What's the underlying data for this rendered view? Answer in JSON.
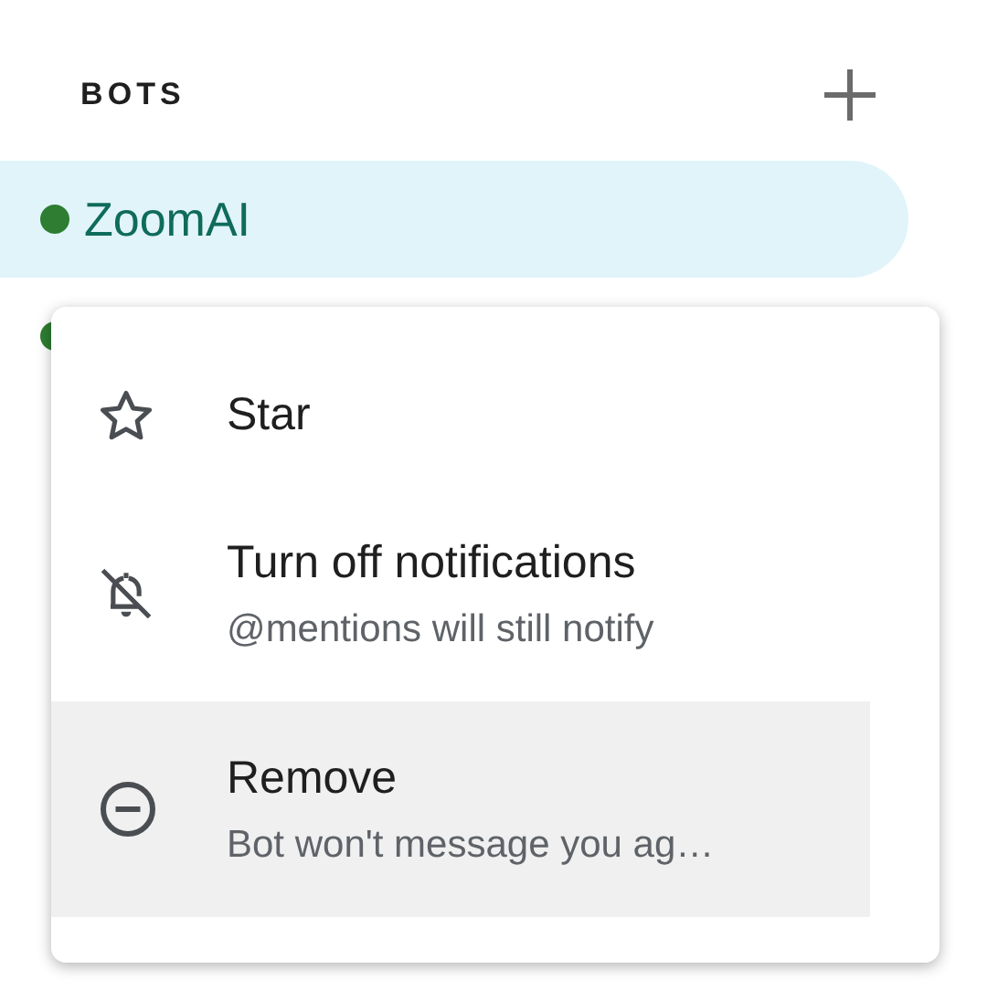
{
  "section": {
    "title": "BOTS"
  },
  "bots": [
    {
      "name": "ZoomAI",
      "selected": true,
      "online": true
    },
    {
      "online": true,
      "selected": false
    }
  ],
  "menu": {
    "items": [
      {
        "kind": "star",
        "label": "Star",
        "selected": false
      },
      {
        "kind": "mute",
        "label": "Turn off notifications",
        "description": "@mentions will still notify",
        "selected": false
      },
      {
        "kind": "remove",
        "label": "Remove",
        "description": "Bot won't message you ag…",
        "selected": true
      }
    ]
  }
}
